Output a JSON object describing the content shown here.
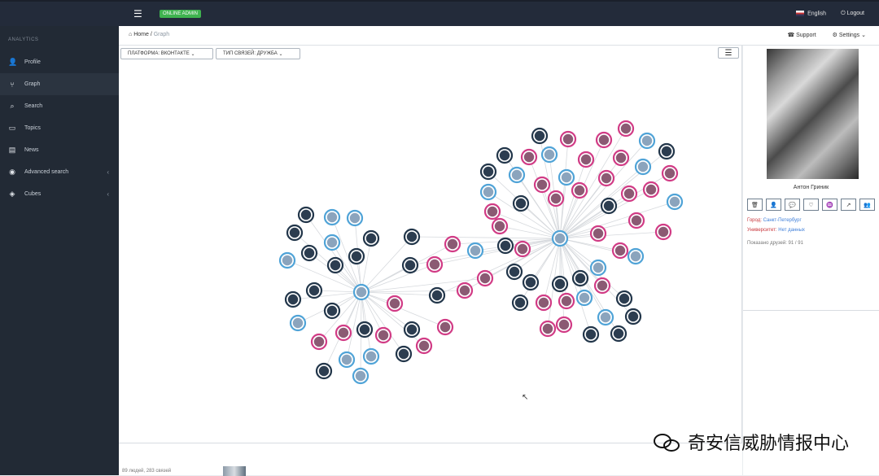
{
  "topbar": {
    "status_badge": "ONLINE ADMIN",
    "language": "English",
    "logout": "Logout"
  },
  "sidebar": {
    "section": "ANALYTICS",
    "items": [
      {
        "label": "Profile",
        "icon": "user-icon",
        "symbol": "👤"
      },
      {
        "label": "Graph",
        "icon": "graph-icon",
        "symbol": "⑂"
      },
      {
        "label": "Search",
        "icon": "search-icon",
        "symbol": "⌕"
      },
      {
        "label": "Topics",
        "icon": "folder-icon",
        "symbol": "▭"
      },
      {
        "label": "News",
        "icon": "news-icon",
        "symbol": "▤"
      },
      {
        "label": "Advanced search",
        "icon": "eye-icon",
        "symbol": "◉"
      },
      {
        "label": "Cubes",
        "icon": "cube-icon",
        "symbol": "◈"
      }
    ]
  },
  "breadcrumb": {
    "home": "Home",
    "current": "Graph"
  },
  "toolbar": {
    "support": "Support",
    "settings": "Settings",
    "platform_filter": "ПЛАТФОРМА: ВКОНТАКТЕ",
    "relation_filter": "ТИП СВЯЗЕЙ: ДРУЖБА"
  },
  "profile": {
    "name": "Антон Гриник",
    "city_label": "Город:",
    "city": "Санкт-Петербург",
    "university_label": "Университет:",
    "university": "Нет данных",
    "friends_shown": "Показано друзей: 91 / 91"
  },
  "footer": {
    "stats": "89 людей, 283 связей"
  },
  "watermark": {
    "text": "奇安信威胁情报中心"
  },
  "graph": {
    "colors": {
      "blue": "#4fa3d7",
      "pink": "#d13b85",
      "dark": "#22364a"
    },
    "nodes": [
      [
        376,
        264,
        "dark"
      ],
      [
        408,
        267,
        "blue"
      ],
      [
        436,
        268,
        "blue"
      ],
      [
        362,
        286,
        "dark"
      ],
      [
        408,
        298,
        "blue"
      ],
      [
        380,
        311,
        "dark"
      ],
      [
        353,
        320,
        "blue"
      ],
      [
        412,
        326,
        "dark"
      ],
      [
        438,
        315,
        "dark"
      ],
      [
        456,
        293,
        "dark"
      ],
      [
        386,
        357,
        "dark"
      ],
      [
        444,
        359,
        "blue"
      ],
      [
        360,
        368,
        "dark"
      ],
      [
        408,
        382,
        "dark"
      ],
      [
        366,
        397,
        "blue"
      ],
      [
        485,
        373,
        "pink"
      ],
      [
        392,
        420,
        "pink"
      ],
      [
        422,
        409,
        "pink"
      ],
      [
        448,
        405,
        "dark"
      ],
      [
        471,
        412,
        "pink"
      ],
      [
        506,
        405,
        "dark"
      ],
      [
        496,
        435,
        "dark"
      ],
      [
        456,
        438,
        "blue"
      ],
      [
        426,
        442,
        "blue"
      ],
      [
        398,
        456,
        "dark"
      ],
      [
        443,
        462,
        "blue"
      ],
      [
        521,
        425,
        "pink"
      ],
      [
        547,
        402,
        "pink"
      ],
      [
        506,
        291,
        "dark"
      ],
      [
        556,
        300,
        "pink"
      ],
      [
        504,
        326,
        "dark"
      ],
      [
        534,
        325,
        "pink"
      ],
      [
        584,
        308,
        "blue"
      ],
      [
        537,
        363,
        "dark"
      ],
      [
        571,
        357,
        "pink"
      ],
      [
        596,
        342,
        "pink"
      ],
      [
        621,
        302,
        "dark"
      ],
      [
        614,
        278,
        "pink"
      ],
      [
        642,
        306,
        "pink"
      ],
      [
        632,
        334,
        "dark"
      ],
      [
        652,
        347,
        "dark"
      ],
      [
        688,
        293,
        "blue"
      ],
      [
        688,
        349,
        "dark"
      ],
      [
        713,
        342,
        "dark"
      ],
      [
        735,
        329,
        "blue"
      ],
      [
        740,
        351,
        "pink"
      ],
      [
        639,
        372,
        "dark"
      ],
      [
        668,
        372,
        "pink"
      ],
      [
        696,
        370,
        "pink"
      ],
      [
        718,
        366,
        "blue"
      ],
      [
        767,
        367,
        "dark"
      ],
      [
        673,
        404,
        "pink"
      ],
      [
        693,
        399,
        "pink"
      ],
      [
        744,
        390,
        "blue"
      ],
      [
        778,
        389,
        "dark"
      ],
      [
        726,
        411,
        "dark"
      ],
      [
        760,
        410,
        "dark"
      ],
      [
        663,
        167,
        "dark"
      ],
      [
        698,
        171,
        "pink"
      ],
      [
        742,
        172,
        "pink"
      ],
      [
        769,
        158,
        "pink"
      ],
      [
        795,
        173,
        "blue"
      ],
      [
        819,
        186,
        "dark"
      ],
      [
        620,
        191,
        "dark"
      ],
      [
        650,
        193,
        "pink"
      ],
      [
        675,
        190,
        "blue"
      ],
      [
        720,
        196,
        "pink"
      ],
      [
        763,
        194,
        "pink"
      ],
      [
        600,
        211,
        "dark"
      ],
      [
        635,
        215,
        "blue"
      ],
      [
        666,
        227,
        "pink"
      ],
      [
        696,
        218,
        "blue"
      ],
      [
        745,
        219,
        "pink"
      ],
      [
        790,
        205,
        "blue"
      ],
      [
        823,
        213,
        "pink"
      ],
      [
        600,
        236,
        "blue"
      ],
      [
        640,
        250,
        "dark"
      ],
      [
        683,
        244,
        "pink"
      ],
      [
        712,
        234,
        "pink"
      ],
      [
        748,
        253,
        "dark"
      ],
      [
        773,
        238,
        "pink"
      ],
      [
        800,
        233,
        "pink"
      ],
      [
        829,
        248,
        "blue"
      ],
      [
        605,
        260,
        "pink"
      ],
      [
        782,
        271,
        "pink"
      ],
      [
        815,
        285,
        "pink"
      ],
      [
        735,
        287,
        "pink"
      ],
      [
        762,
        308,
        "pink"
      ],
      [
        781,
        315,
        "blue"
      ]
    ],
    "edges": [
      [
        41,
        36
      ],
      [
        41,
        37
      ],
      [
        41,
        38
      ],
      [
        41,
        39
      ],
      [
        41,
        40
      ],
      [
        41,
        42
      ],
      [
        41,
        43
      ],
      [
        41,
        44
      ],
      [
        41,
        45
      ],
      [
        41,
        57
      ],
      [
        41,
        58
      ],
      [
        41,
        59
      ],
      [
        41,
        60
      ],
      [
        41,
        61
      ],
      [
        41,
        62
      ],
      [
        41,
        63
      ],
      [
        41,
        64
      ],
      [
        41,
        65
      ],
      [
        41,
        66
      ],
      [
        41,
        67
      ],
      [
        41,
        68
      ],
      [
        41,
        69
      ],
      [
        41,
        70
      ],
      [
        41,
        71
      ],
      [
        41,
        72
      ],
      [
        41,
        73
      ],
      [
        41,
        74
      ],
      [
        41,
        75
      ],
      [
        41,
        76
      ],
      [
        41,
        77
      ],
      [
        41,
        78
      ],
      [
        41,
        79
      ],
      [
        41,
        80
      ],
      [
        41,
        81
      ],
      [
        41,
        82
      ],
      [
        41,
        83
      ],
      [
        41,
        84
      ],
      [
        41,
        85
      ],
      [
        41,
        86
      ],
      [
        41,
        87
      ],
      [
        41,
        88
      ],
      [
        41,
        35
      ],
      [
        41,
        32
      ],
      [
        41,
        29
      ],
      [
        11,
        0
      ],
      [
        11,
        1
      ],
      [
        11,
        2
      ],
      [
        11,
        3
      ],
      [
        11,
        4
      ],
      [
        11,
        5
      ],
      [
        11,
        6
      ],
      [
        11,
        7
      ],
      [
        11,
        8
      ],
      [
        11,
        9
      ],
      [
        11,
        10
      ],
      [
        11,
        12
      ],
      [
        11,
        13
      ],
      [
        11,
        14
      ],
      [
        11,
        15
      ],
      [
        11,
        16
      ],
      [
        11,
        17
      ],
      [
        11,
        18
      ],
      [
        11,
        19
      ],
      [
        11,
        20
      ],
      [
        11,
        21
      ],
      [
        11,
        22
      ],
      [
        11,
        23
      ],
      [
        11,
        24
      ],
      [
        11,
        25
      ],
      [
        11,
        26
      ],
      [
        11,
        27
      ],
      [
        11,
        28
      ],
      [
        11,
        29
      ],
      [
        11,
        30
      ],
      [
        11,
        31
      ],
      [
        11,
        33
      ],
      [
        11,
        34
      ],
      [
        11,
        35
      ],
      [
        33,
        41
      ],
      [
        34,
        41
      ],
      [
        30,
        41
      ],
      [
        31,
        41
      ],
      [
        28,
        41
      ],
      [
        46,
        41
      ],
      [
        47,
        41
      ],
      [
        48,
        41
      ],
      [
        49,
        41
      ],
      [
        50,
        41
      ],
      [
        51,
        41
      ],
      [
        52,
        41
      ],
      [
        53,
        41
      ],
      [
        54,
        41
      ],
      [
        55,
        41
      ],
      [
        56,
        41
      ]
    ]
  }
}
